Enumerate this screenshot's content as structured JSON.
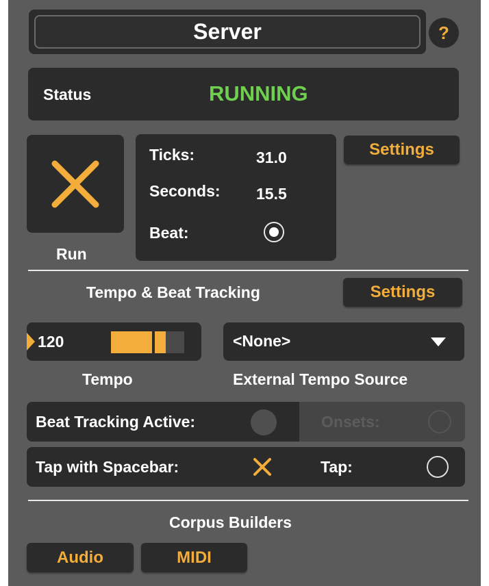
{
  "header": {
    "title": "Server",
    "help_label": "?"
  },
  "status": {
    "label": "Status",
    "value": "RUNNING",
    "value_color": "#6fcf4e"
  },
  "run": {
    "label": "Run",
    "icon": "x-icon"
  },
  "counters": {
    "ticks_label": "Ticks:",
    "ticks_value": "31.0",
    "seconds_label": "Seconds:",
    "seconds_value": "15.5",
    "beat_label": "Beat:"
  },
  "server_settings_label": "Settings",
  "tempo_section": {
    "title": "Tempo & Beat Tracking",
    "settings_label": "Settings",
    "tempo_value": "120",
    "tempo_label": "Tempo",
    "tempo_meter_fraction": 0.75,
    "external_source_value": "<None>",
    "external_source_label": "External Tempo Source"
  },
  "beat_tracking": {
    "active_label": "Beat Tracking Active:",
    "onsets_label": "Onsets:"
  },
  "tap": {
    "spacebar_label": "Tap with Spacebar:",
    "tap_label": "Tap:"
  },
  "corpus": {
    "title": "Corpus Builders",
    "audio_label": "Audio",
    "midi_label": "MIDI"
  },
  "colors": {
    "accent": "#f2ad3a",
    "panel": "#5b5b5b",
    "control": "#2b2b2b"
  }
}
